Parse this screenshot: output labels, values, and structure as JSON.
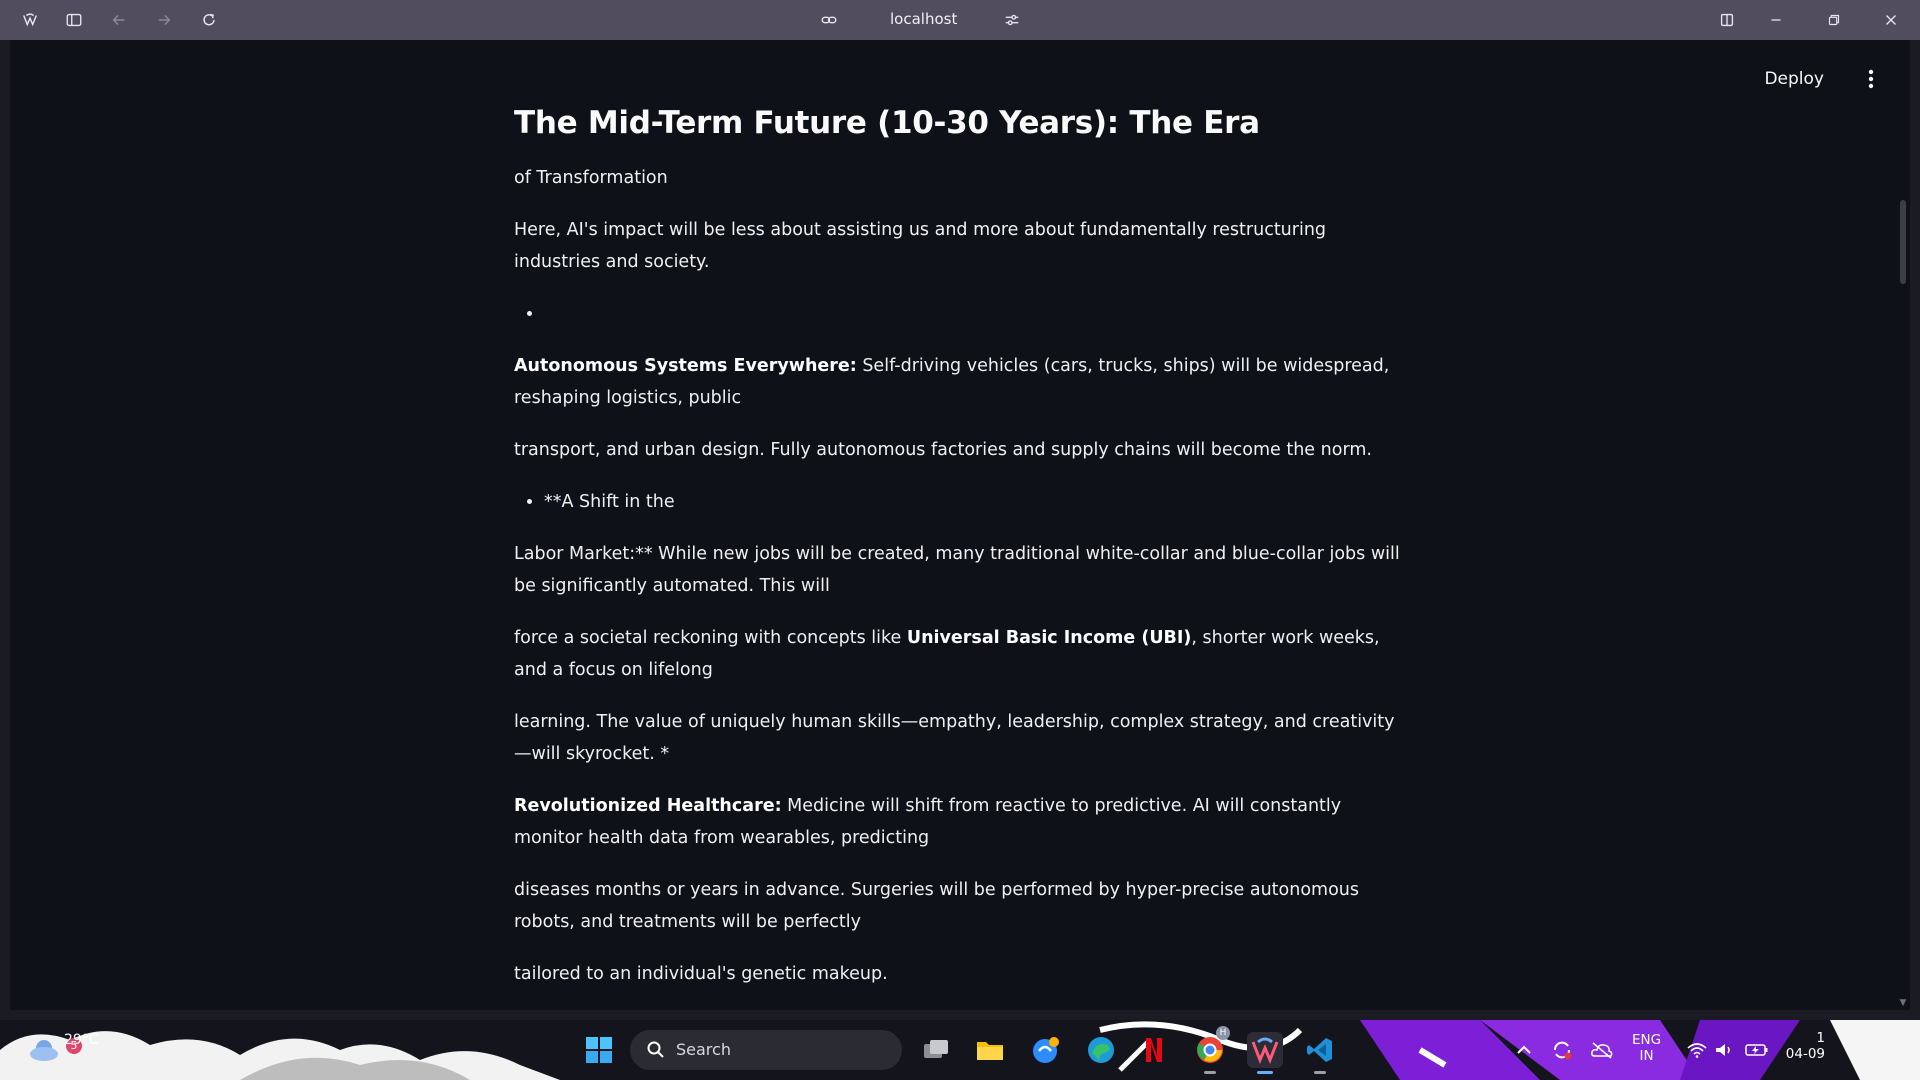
{
  "browser": {
    "url": "localhost"
  },
  "app": {
    "deploy_label": "Deploy",
    "heading": "The Mid-Term Future (10-30 Years): The Era",
    "paragraphs": {
      "p1": "of Transformation",
      "p2": "Here, AI's impact will be less about assisting us and more about fundamentally restructuring industries and society.",
      "p3_bold": "Autonomous Systems Everywhere:",
      "p3_text": " Self-driving vehicles (cars, trucks, ships) will be widespread, reshaping logistics, public",
      "p4": "transport, and urban design. Fully autonomous factories and supply chains will become the norm.",
      "bullet2": "**A Shift in the",
      "p5": "Labor Market:** While new jobs will be created, many traditional white-collar and blue-collar jobs will be significantly automated. This will",
      "p6_a": "force a societal reckoning with concepts like ",
      "p6_bold": "Universal Basic Income (UBI)",
      "p6_b": ", shorter work weeks, and a focus on lifelong",
      "p7": "learning. The value of uniquely human skills—empathy, leadership, complex strategy, and creativity—will skyrocket. *",
      "p8_bold": "Revolutionized Healthcare:",
      "p8_text": " Medicine will shift from reactive to predictive. AI will constantly monitor health data from wearables, predicting",
      "p9": "diseases months or years in advance. Surgeries will be performed by hyper-precise autonomous robots, and treatments will be perfectly",
      "p10": "tailored to an individual's genetic makeup."
    }
  },
  "taskbar": {
    "weather_temp": "29°C",
    "weather_badge": "5",
    "search_label": "Search",
    "language": "ENG",
    "region": "IN",
    "date_partial": "04-09",
    "time_partial": "1",
    "chrome_badge": "H"
  },
  "colors": {
    "app_bg": "#0e1117",
    "titlebar": "#514d5f",
    "accent": "#5fb2ff"
  }
}
